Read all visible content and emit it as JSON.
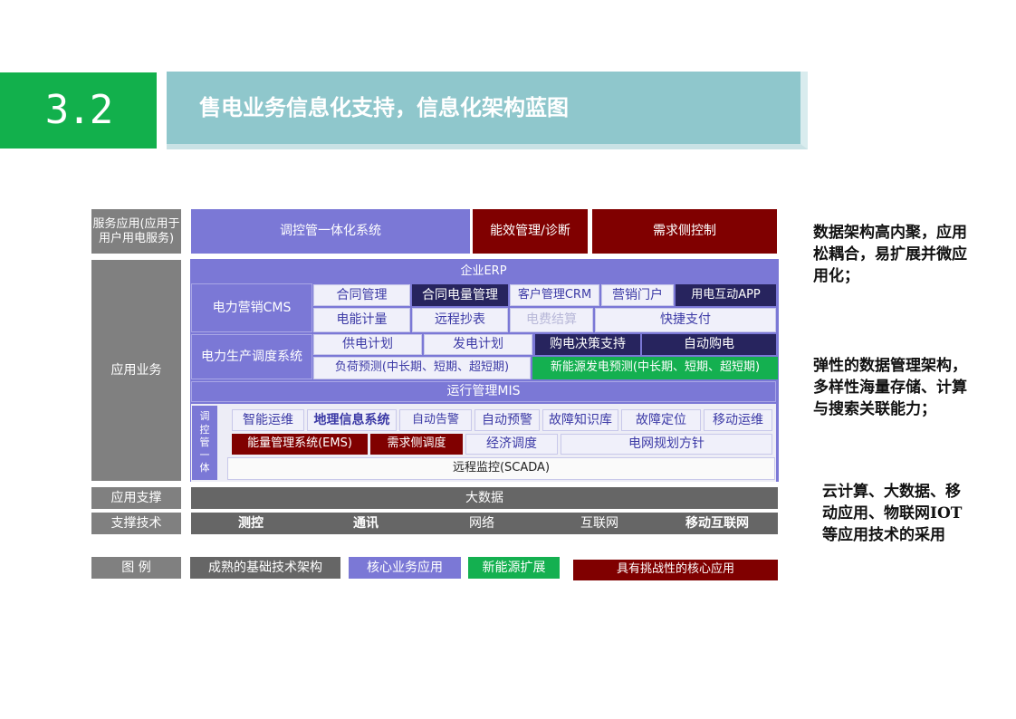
{
  "header": {
    "number": "3.2",
    "title": "售电业务信息化支持，信息化架构蓝图"
  },
  "categories": {
    "service": "服务应用(应用于用户用电服务)",
    "business": "应用业务",
    "support": "应用支撑",
    "tech": "支撑技术",
    "legend": "图 例"
  },
  "service_row": {
    "integrated": "调控管一体化系统",
    "efficiency": "能效管理/诊断",
    "demand": "需求侧控制"
  },
  "erp": "企业ERP",
  "cms": {
    "title": "电力营销CMS",
    "row1": [
      "合同管理",
      "合同电量管理",
      "客户管理CRM",
      "营销门户",
      "用电互动APP"
    ],
    "row2": [
      "电能计量",
      "远程抄表",
      "电费结算",
      "快捷支付"
    ]
  },
  "dispatch": {
    "title": "电力生产调度系统",
    "row1": [
      "供电计划",
      "发电计划",
      "购电决策支持",
      "自动购电"
    ],
    "load_forecast": "负荷预测(中长期、短期、超短期)",
    "renewable_forecast": "新能源发电预测(中长期、短期、超短期)"
  },
  "mis": "运行管理MIS",
  "control": {
    "vertical": "调控管一体",
    "row1": [
      "智能运维",
      "地理信息系统",
      "自动告警",
      "自动预警",
      "故障知识库",
      "故障定位",
      "移动运维"
    ],
    "row2": [
      "能量管理系统(EMS)",
      "需求侧调度",
      "经济调度",
      "电网规划方针"
    ],
    "scada": "远程监控(SCADA)"
  },
  "bigdata": "大数据",
  "tech_items": [
    "测控",
    "通讯",
    "网络",
    "互联网",
    "移动互联网"
  ],
  "legend": [
    "成熟的基础技术架构",
    "核心业务应用",
    "新能源扩展",
    "具有挑战性的核心应用"
  ],
  "notes": [
    "数据架构高内聚，应用松耦合，易扩展并微应用化；",
    "弹性的数据管理架构，多样性海量存储、计算与搜索关联能力；",
    "云计算、大数据、移动应用、物联网IOT等应用技术的采用"
  ],
  "colors": {
    "core": "#7b78d6",
    "mature": "#666666",
    "renewable": "#14b050",
    "challenge": "#800000",
    "header_green": "#12b04c",
    "title_bar": "#8fc7cc"
  }
}
